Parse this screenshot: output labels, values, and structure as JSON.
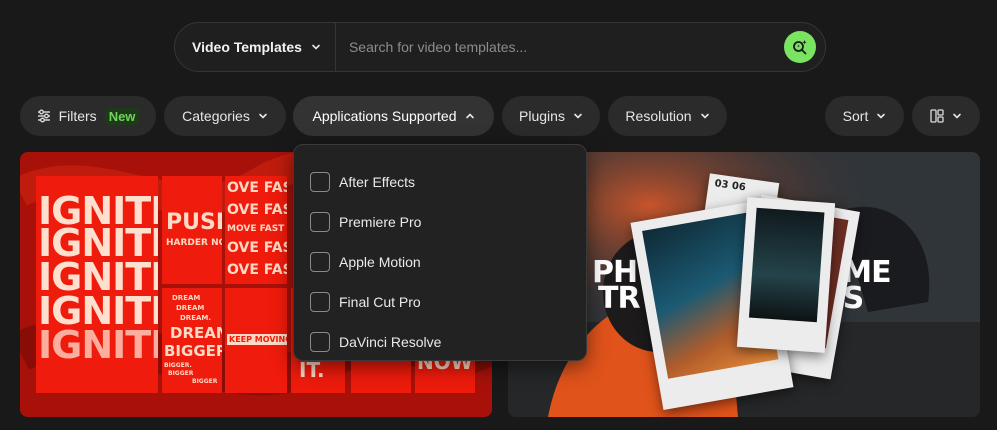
{
  "search": {
    "type_label": "Video Templates",
    "placeholder": "Search for video templates..."
  },
  "filters": {
    "filters_label": "Filters",
    "new_badge": "New",
    "categories_label": "Categories",
    "applications_label": "Applications Supported",
    "plugins_label": "Plugins",
    "resolution_label": "Resolution",
    "sort_label": "Sort"
  },
  "applications_dropdown": {
    "options": [
      {
        "label": "After Effects",
        "checked": false
      },
      {
        "label": "Premiere Pro",
        "checked": false
      },
      {
        "label": "Apple Motion",
        "checked": false
      },
      {
        "label": "Final Cut Pro",
        "checked": false
      },
      {
        "label": "DaVinci Resolve",
        "checked": false
      }
    ]
  },
  "cards": {
    "left": {
      "ignite_lines": [
        "IGNITE.",
        "IGNITE.",
        "IGNITE.",
        "IGNITE.",
        "IGNITE."
      ],
      "push": "PUSH",
      "harder_now": "HARDER NOW",
      "move_fast_lines": [
        "OVE FAS",
        "OVE FAS",
        "MOVE FAST S",
        "OVE FAS",
        "OVE FAS"
      ],
      "dream_small": [
        "DREAM",
        "DREAM",
        "DREAM."
      ],
      "dream_big": "DREAM",
      "bigger": "BIGGER.",
      "bigger_small": [
        "BIGGER.",
        "BIGGER",
        "BIGGER"
      ],
      "keep_moving": "KEEP MOVING",
      "it": "IT.",
      "now": "NOW"
    },
    "right": {
      "headline_left": [
        "PH",
        "TR"
      ],
      "headline_right": [
        "AME",
        "ONS"
      ],
      "tag": "03 06"
    }
  },
  "colors": {
    "accent_green": "#7ae462",
    "background": "#191919",
    "pill": "#2b2b2b",
    "card_red": "#ef1b0c"
  }
}
